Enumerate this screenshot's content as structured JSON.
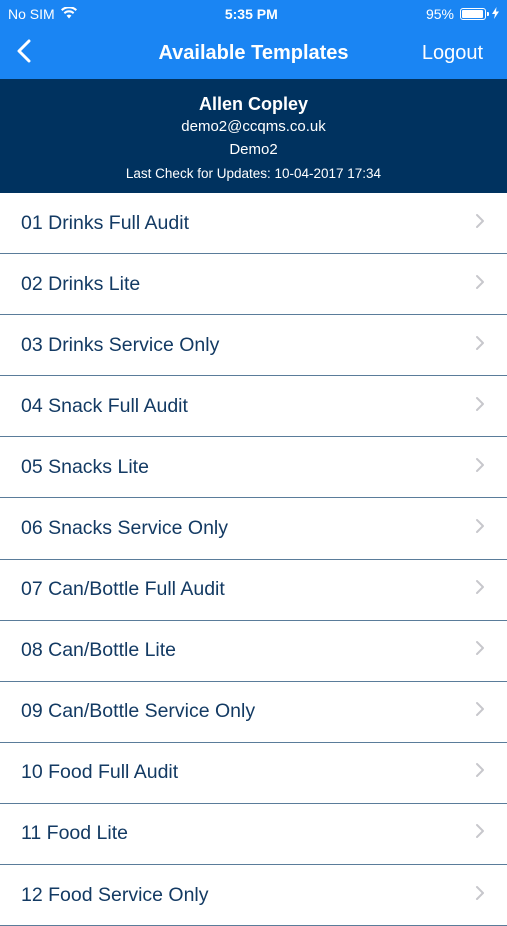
{
  "status_bar": {
    "carrier": "No SIM",
    "time": "5:35 PM",
    "battery_percent": "95%",
    "battery_level": 0.95
  },
  "nav": {
    "back_icon": "chevron-left-icon",
    "title": "Available Templates",
    "logout_label": "Logout"
  },
  "user": {
    "name": "Allen Copley",
    "email": "demo2@ccqms.co.uk",
    "company": "Demo2",
    "last_check": "Last Check for Updates: 10-04-2017 17:34"
  },
  "templates": [
    "01 Drinks Full Audit",
    "02 Drinks Lite",
    "03 Drinks Service Only",
    "04 Snack Full Audit",
    "05 Snacks Lite",
    "06 Snacks Service Only",
    "07 Can/Bottle Full Audit",
    "08 Can/Bottle Lite",
    "09 Can/Bottle Service Only",
    "10 Food Full Audit",
    "11 Food Lite",
    "12 Food Service Only"
  ],
  "colors": {
    "nav_blue": "#1a85f3",
    "header_navy": "#00325f",
    "row_text": "#133a63",
    "chevron": "#c7c7cc"
  }
}
